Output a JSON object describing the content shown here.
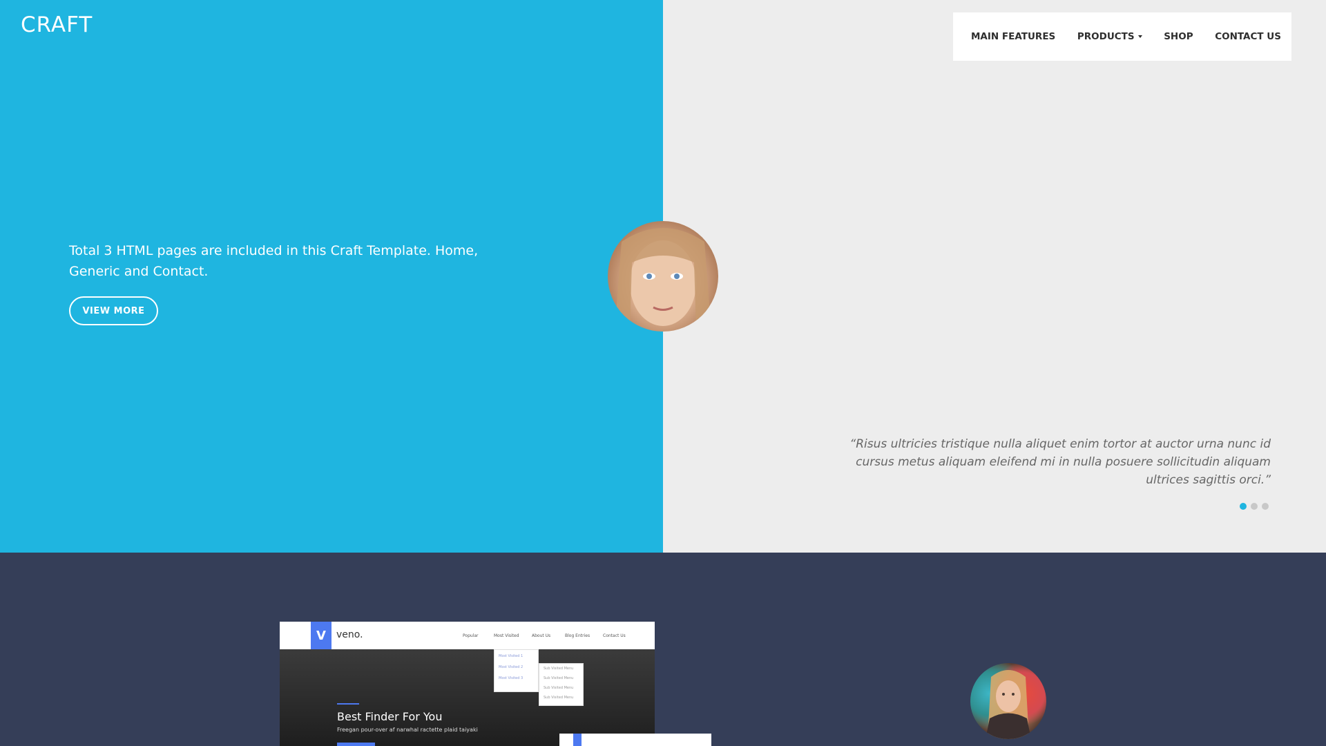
{
  "brand": {
    "logo": "CRAFT"
  },
  "nav": {
    "items": [
      {
        "label": "MAIN FEATURES"
      },
      {
        "label": "PRODUCTS",
        "has_dropdown": true
      },
      {
        "label": "SHOP"
      },
      {
        "label": "CONTACT US"
      }
    ]
  },
  "hero": {
    "text": "Total 3 HTML pages are included in this Craft Template. Home, Generic and Contact.",
    "button_label": "VIEW MORE",
    "accent_color": "#1fb5e0",
    "background_right": "#ededed"
  },
  "testimonial": {
    "quote": "“Risus ultricies tristique nulla aliquet enim tortor at auctor urna nunc id cursus metus aliquam eleifend mi in nulla posuere sollicitudin aliquam ultrices sagittis orci.”",
    "slides": 3,
    "active_slide": 1
  },
  "lower": {
    "background": "#353e58",
    "mockup": {
      "brand": "veno.",
      "logo_letter": "V",
      "nav": [
        "Popular",
        "Most Visited",
        "About Us",
        "Blog Entries",
        "Contact Us"
      ],
      "dropdown_a": [
        "Most Visited 1",
        "Most Visited 2",
        "Most Visited 3"
      ],
      "dropdown_b": [
        "Sub Visited Menu",
        "Sub Visited Menu",
        "Sub Visited Menu",
        "Sub Visited Menu"
      ],
      "title": "Best Finder For You",
      "subtitle": "Freegan pour-over af narwhal ractette plaid taiyaki"
    }
  }
}
